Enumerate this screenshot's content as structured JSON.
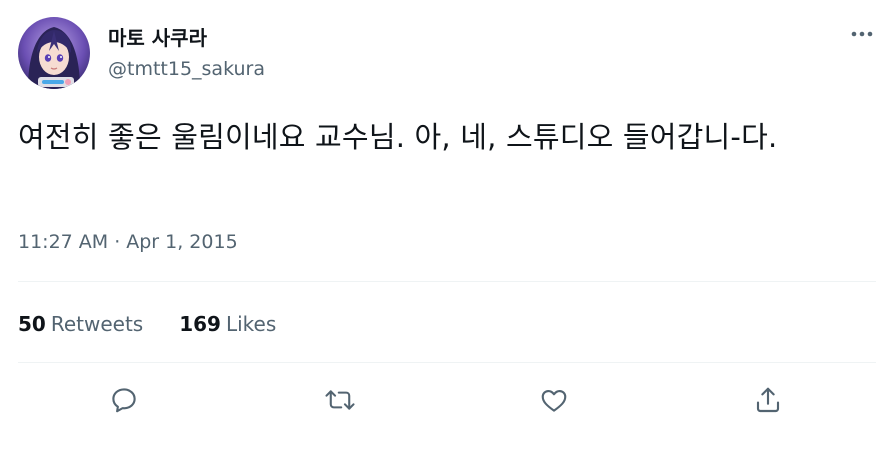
{
  "author": {
    "display_name": "마토 사쿠라",
    "handle": "@tmtt15_sakura"
  },
  "tweet": {
    "text": "여전히 좋은 울림이네요 교수님. 아, 네, 스튜디오 들어갑니-다.",
    "time": "11:27 AM",
    "separator": "·",
    "date": "Apr 1, 2015"
  },
  "stats": {
    "retweets_count": "50",
    "retweets_label": "Retweets",
    "likes_count": "169",
    "likes_label": "Likes"
  },
  "icons": {
    "more": "more-horizontal-icon",
    "reply": "reply-icon",
    "retweet": "retweet-icon",
    "like": "heart-icon",
    "share": "share-icon"
  },
  "colors": {
    "text_primary": "#0f1419",
    "text_secondary": "#536471",
    "divider": "#eff3f4"
  }
}
